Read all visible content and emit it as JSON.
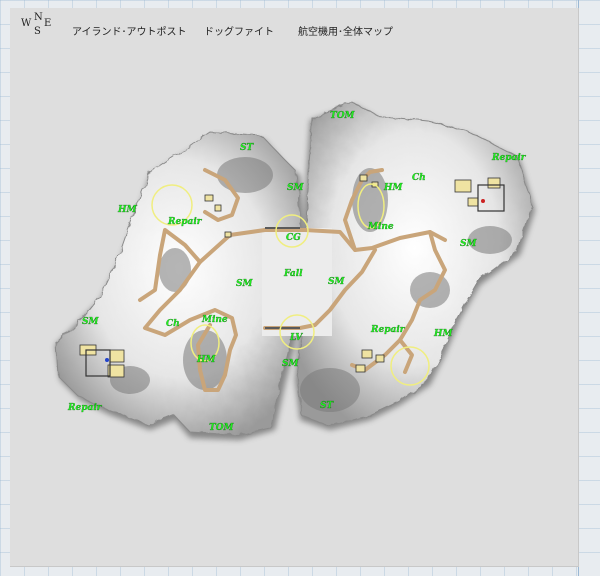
{
  "header": {
    "compass": {
      "north": "N",
      "south": "S",
      "west": "W",
      "east": "E"
    },
    "title_left": "アイランド･アウトポスト",
    "title_mid": "ドッグファイト",
    "title_right": "航空機用･全体マップ"
  },
  "map_labels": {
    "tom_top": "TOM",
    "st_top": "ST",
    "repair_ne": "Repair",
    "hm_west": "HM",
    "sm_nw": "SM",
    "hm_nne": "HM",
    "ch_ne": "Ch",
    "repair_nw": "Repair",
    "cg": "CG",
    "mine_ne": "Mine",
    "sm_east": "SM",
    "fall": "Fall",
    "sm_center_left": "SM",
    "sm_center_right": "SM",
    "sm_west": "SM",
    "ch_west": "Ch",
    "mine_sw": "Mine",
    "repair_se": "Repair",
    "hm_se": "HM",
    "lv": "LV",
    "hm_sw": "HM",
    "sm_south": "SM",
    "repair_sw": "Repair",
    "st_bottom": "ST",
    "tom_bottom": "TOM"
  },
  "colors": {
    "paper": "#dedede",
    "terrain": "#f4f4f4",
    "terrain_shadow": "#555555",
    "road": "#c9a57a",
    "circle": "#f0ee80",
    "label": "#22ee22"
  }
}
